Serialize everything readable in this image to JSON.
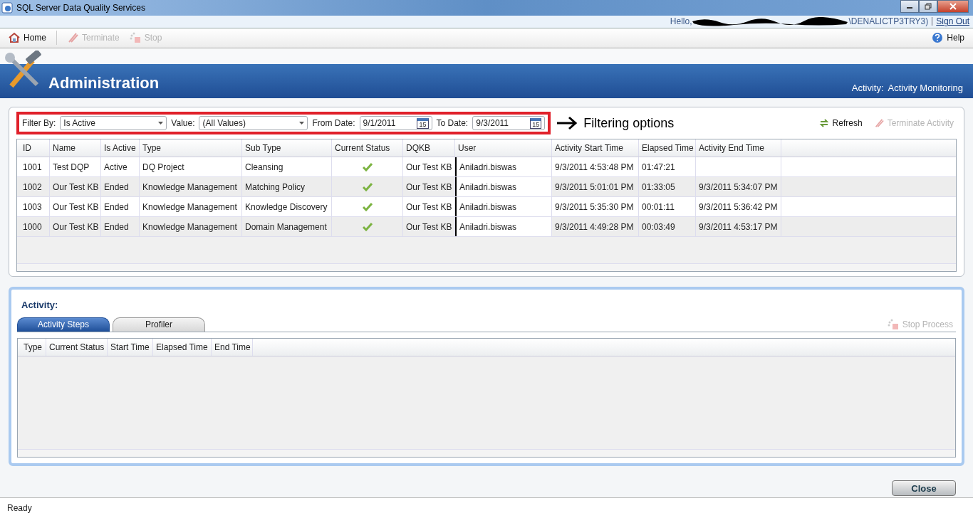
{
  "window": {
    "title": "SQL Server Data Quality Services"
  },
  "user_strip": {
    "greeting": "Hello,",
    "account_suffix": "\\DENALICTP3TRY3)",
    "sign_out": "Sign Out"
  },
  "toolbar": {
    "items": [
      {
        "label": "Home",
        "kind": "home",
        "disabled": false
      },
      {
        "label": "Terminate",
        "kind": "terminate",
        "disabled": true
      },
      {
        "label": "Stop",
        "kind": "stop",
        "disabled": true
      }
    ],
    "help": "Help"
  },
  "banner": {
    "title": "Administration",
    "activity_label": "Activity:",
    "activity_name": "Activity Monitoring"
  },
  "filters": {
    "filter_by_label": "Filter By:",
    "filter_by": "Is Active",
    "value_label": "Value:",
    "value": "(All Values)",
    "from_label": "From Date:",
    "from": "9/1/2011",
    "to_label": "To Date:",
    "to": "9/3/2011",
    "from_calendar_day": "15",
    "to_calendar_day": "15"
  },
  "annotation": {
    "text": "Filtering options"
  },
  "actions": [
    {
      "label": "Refresh",
      "kind": "refresh",
      "disabled": false
    },
    {
      "label": "Terminate Activity",
      "kind": "terminate",
      "disabled": true
    }
  ],
  "table": {
    "columns": [
      "ID",
      "Name",
      "Is Active",
      "Type",
      "Sub Type",
      "Current Status",
      "DQKB",
      "User",
      "Activity Start Time",
      "Elapsed Time",
      "Activity End Time"
    ],
    "rows": [
      {
        "cells": [
          "1001",
          "Test DQP",
          "Active",
          "DQ Project",
          "Cleansing",
          "",
          "Our Test KB",
          "Aniladri.biswas",
          "9/3/2011 4:53:48 PM",
          "01:47:21",
          ""
        ],
        "status_ok": true
      },
      {
        "cells": [
          "1002",
          "Our Test KB",
          "Ended",
          "Knowledge Management",
          "Matching Policy",
          "",
          "Our Test KB",
          "Aniladri.biswas",
          "9/3/2011 5:01:01 PM",
          "01:33:05",
          "9/3/2011 5:34:07 PM"
        ],
        "status_ok": true
      },
      {
        "cells": [
          "1003",
          "Our Test KB",
          "Ended",
          "Knowledge Management",
          "Knowledge Discovery",
          "",
          "Our Test KB",
          "Aniladri.biswas",
          "9/3/2011 5:35:30 PM",
          "00:01:11",
          "9/3/2011 5:36:42 PM"
        ],
        "status_ok": true
      },
      {
        "cells": [
          "1000",
          "Our Test KB",
          "Ended",
          "Knowledge Management",
          "Domain Management",
          "",
          "Our Test KB",
          "Aniladri.biswas",
          "9/3/2011 4:49:28 PM",
          "00:03:49",
          "9/3/2011 4:53:17 PM"
        ],
        "status_ok": true
      }
    ]
  },
  "activity": {
    "heading": "Activity:",
    "tabs": [
      {
        "label": "Activity Steps",
        "selected": true
      },
      {
        "label": "Profiler",
        "selected": false
      }
    ],
    "stop_process": {
      "label": "Stop Process",
      "disabled": true
    },
    "columns": [
      "Type",
      "Current Status",
      "Start Time",
      "Elapsed Time",
      "End Time"
    ]
  },
  "close_button": "Close",
  "status_bar": "Ready"
}
